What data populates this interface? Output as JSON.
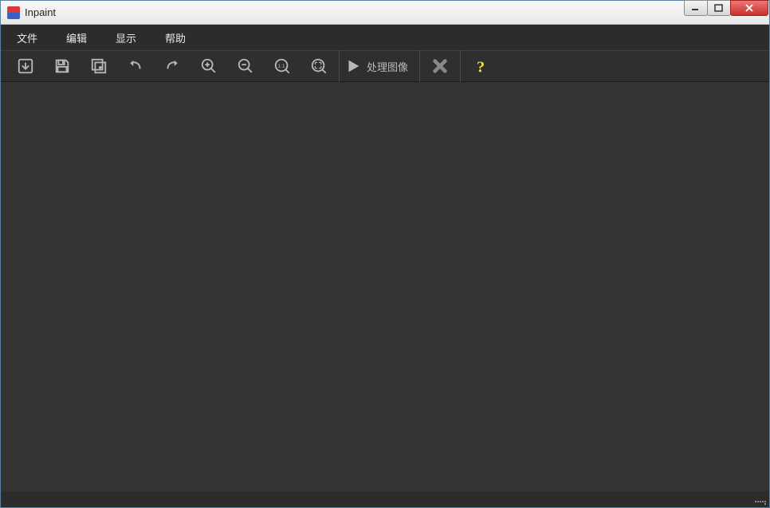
{
  "window": {
    "title": "Inpaint"
  },
  "menu": {
    "file": "文件",
    "edit": "编辑",
    "view": "显示",
    "help": "帮助"
  },
  "toolbar": {
    "process_label": "处理图像"
  }
}
